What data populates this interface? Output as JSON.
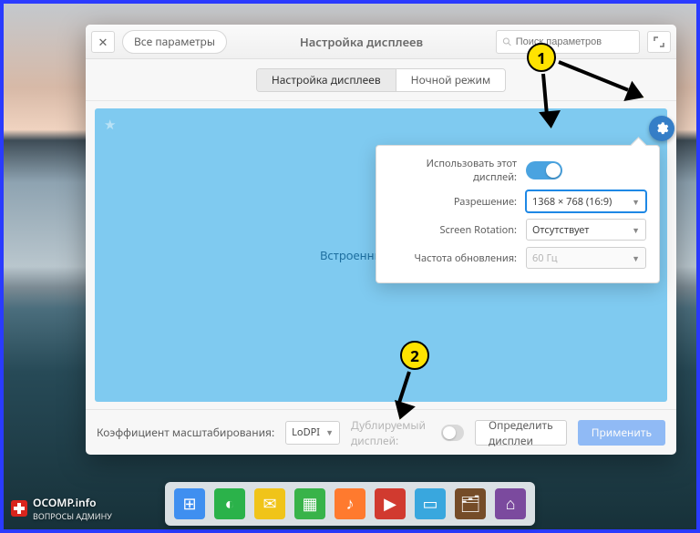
{
  "header": {
    "all_params_label": "Все параметры",
    "title": "Настройка дисплеев",
    "search_placeholder": "Поиск параметров"
  },
  "tabs": {
    "displays": "Настройка дисплеев",
    "night": "Ночной режим"
  },
  "canvas": {
    "builtin_label": "Встроенный дисплей"
  },
  "popup": {
    "use_display_label": "Использовать этот дисплей:",
    "use_display_on": true,
    "resolution_label": "Разрешение:",
    "resolution_value": "1368 × 768 (16:9)",
    "rotation_label": "Screen Rotation:",
    "rotation_value": "Отсутствует",
    "refresh_label": "Частота обновления:",
    "refresh_value": "60 Гц"
  },
  "footer": {
    "scale_label": "Коэффициент масштабирования:",
    "scale_value": "LoDPI",
    "mirror_label": "Дублируемый дисплей:",
    "detect_label": "Определить дисплеи",
    "apply_label": "Применить"
  },
  "annotations": {
    "n1": "1",
    "n2": "2"
  },
  "watermark": {
    "line1": "OCOMP.info",
    "line2": "ВОПРОСЫ АДМИНУ"
  },
  "dock_colors": [
    "#3f8ff0",
    "#2bb24a",
    "#f0c419",
    "#38b349",
    "#ff7a2e",
    "#d13a2f",
    "#39a7de",
    "#754c28",
    "#7b4a9e"
  ]
}
